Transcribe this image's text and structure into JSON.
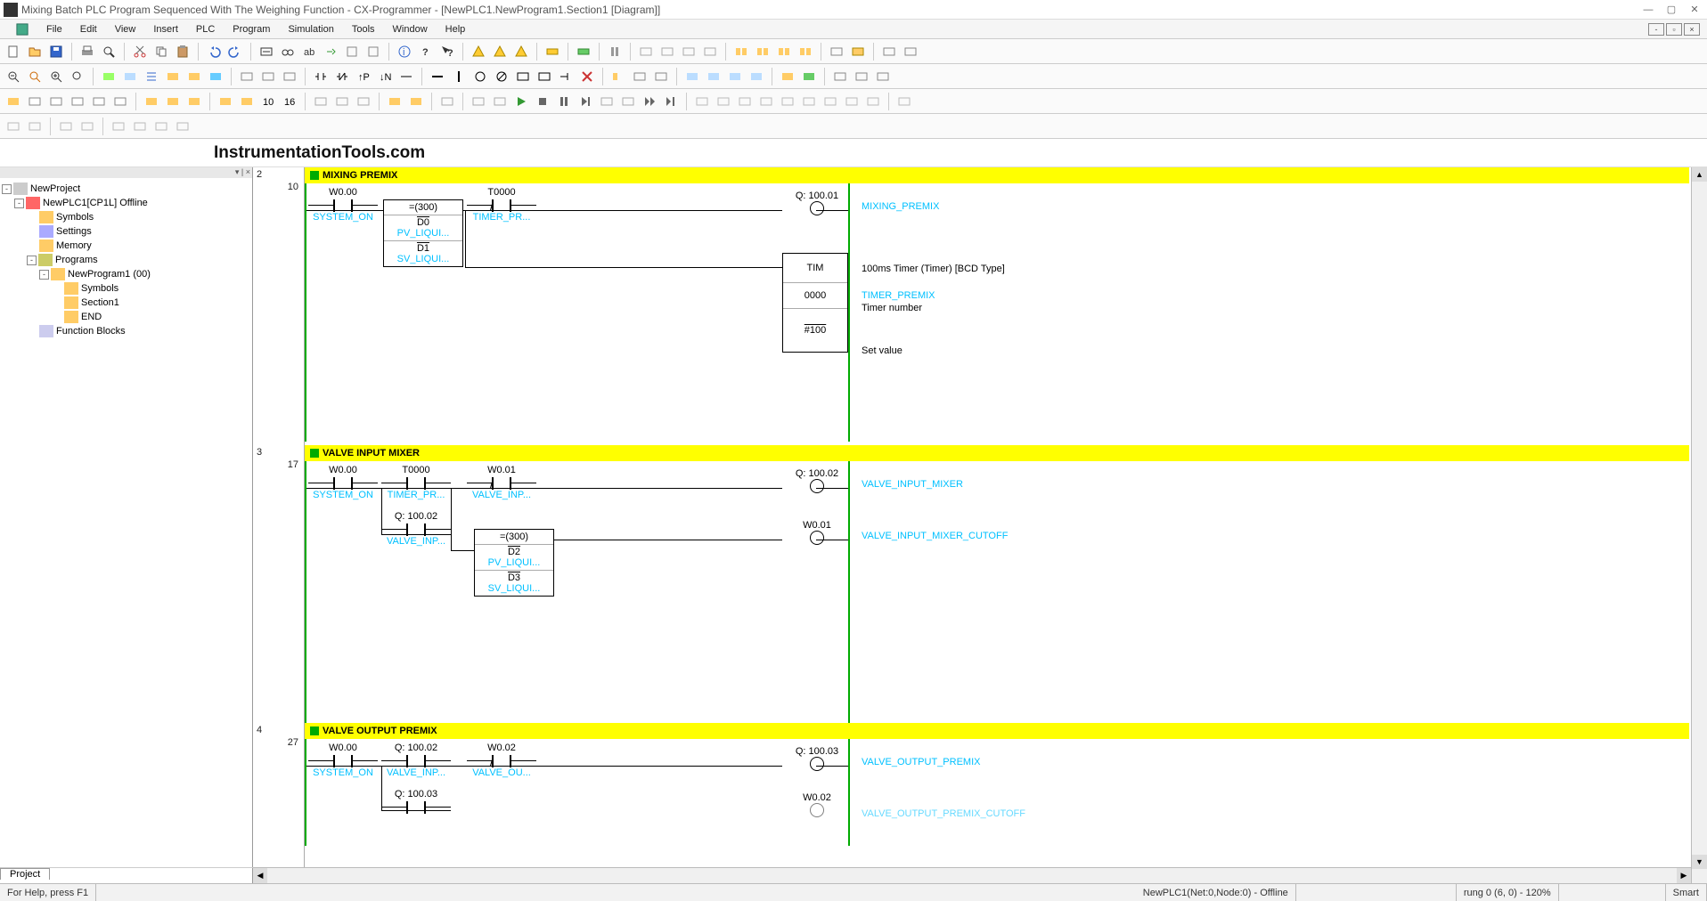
{
  "title": "Mixing Batch PLC Program Sequenced With The Weighing Function - CX-Programmer - [NewPLC1.NewProgram1.Section1 [Diagram]]",
  "menu": [
    "File",
    "Edit",
    "View",
    "Insert",
    "PLC",
    "Program",
    "Simulation",
    "Tools",
    "Window",
    "Help"
  ],
  "brand": "InstrumentationTools.com",
  "tree": {
    "root": "NewProject",
    "plc": "NewPLC1[CP1L] Offline",
    "symbols": "Symbols",
    "settings": "Settings",
    "memory": "Memory",
    "programs": "Programs",
    "program1": "NewProgram1 (00)",
    "p_symbols": "Symbols",
    "section1": "Section1",
    "end": "END",
    "fb": "Function Blocks"
  },
  "proj_tab": "Project",
  "gutter": {
    "r2_num": "2",
    "r2_step": "10",
    "r3_num": "3",
    "r3_step": "17",
    "r4_num": "4",
    "r4_step": "27"
  },
  "rungs": {
    "r2": {
      "title": "MIXING PREMIX",
      "c1_addr": "W0.00",
      "c1_name": "SYSTEM_ON",
      "cmp_op": "=(300)",
      "cmp_d0": "D0",
      "cmp_d0n": "PV_LIQUI...",
      "cmp_d1": "D1",
      "cmp_d1n": "SV_LIQUI...",
      "c2_addr": "T0000",
      "c2_name": "TIMER_PR...",
      "coil_addr": "Q: 100.01",
      "coil_name": "MIXING_PREMIX",
      "tim": "TIM",
      "tim_n": "0000",
      "tim_sv": "#100",
      "tim_desc": "100ms Timer (Timer) [BCD Type]",
      "tim_name": "TIMER_PREMIX",
      "tim_nlbl": "Timer number",
      "tim_svlbl": "Set value"
    },
    "r3": {
      "title": "VALVE INPUT MIXER",
      "c1_addr": "W0.00",
      "c1_name": "SYSTEM_ON",
      "c2_addr": "T0000",
      "c2_name": "TIMER_PR...",
      "c3_addr": "W0.01",
      "c3_name": "VALVE_INP...",
      "coil1_addr": "Q: 100.02",
      "coil1_name": "VALVE_INPUT_MIXER",
      "branch_addr": "Q: 100.02",
      "branch_name": "VALVE_INP...",
      "cmp_op": "=(300)",
      "cmp_d2": "D2",
      "cmp_d2n": "PV_LIQUI...",
      "cmp_d3": "D3",
      "cmp_d3n": "SV_LIQUI...",
      "coil2_addr": "W0.01",
      "coil2_name": "VALVE_INPUT_MIXER_CUTOFF"
    },
    "r4": {
      "title": "VALVE OUTPUT PREMIX",
      "c1_addr": "W0.00",
      "c1_name": "SYSTEM_ON",
      "c2_addr": "Q: 100.02",
      "c2_name": "VALVE_INP...",
      "c3_addr": "W0.02",
      "c3_name": "VALVE_OU...",
      "coil1_addr": "Q: 100.03",
      "coil1_name": "VALVE_OUTPUT_PREMIX",
      "branch_addr": "Q: 100.03",
      "coil2_addr": "W0.02",
      "coil2_name": "VALVE_OUTPUT_PREMIX_CUTOFF"
    }
  },
  "status": {
    "help": "For Help, press F1",
    "conn": "NewPLC1(Net:0,Node:0) - Offline",
    "pos": "rung 0 (6, 0) - 120%",
    "mode": "Smart"
  }
}
